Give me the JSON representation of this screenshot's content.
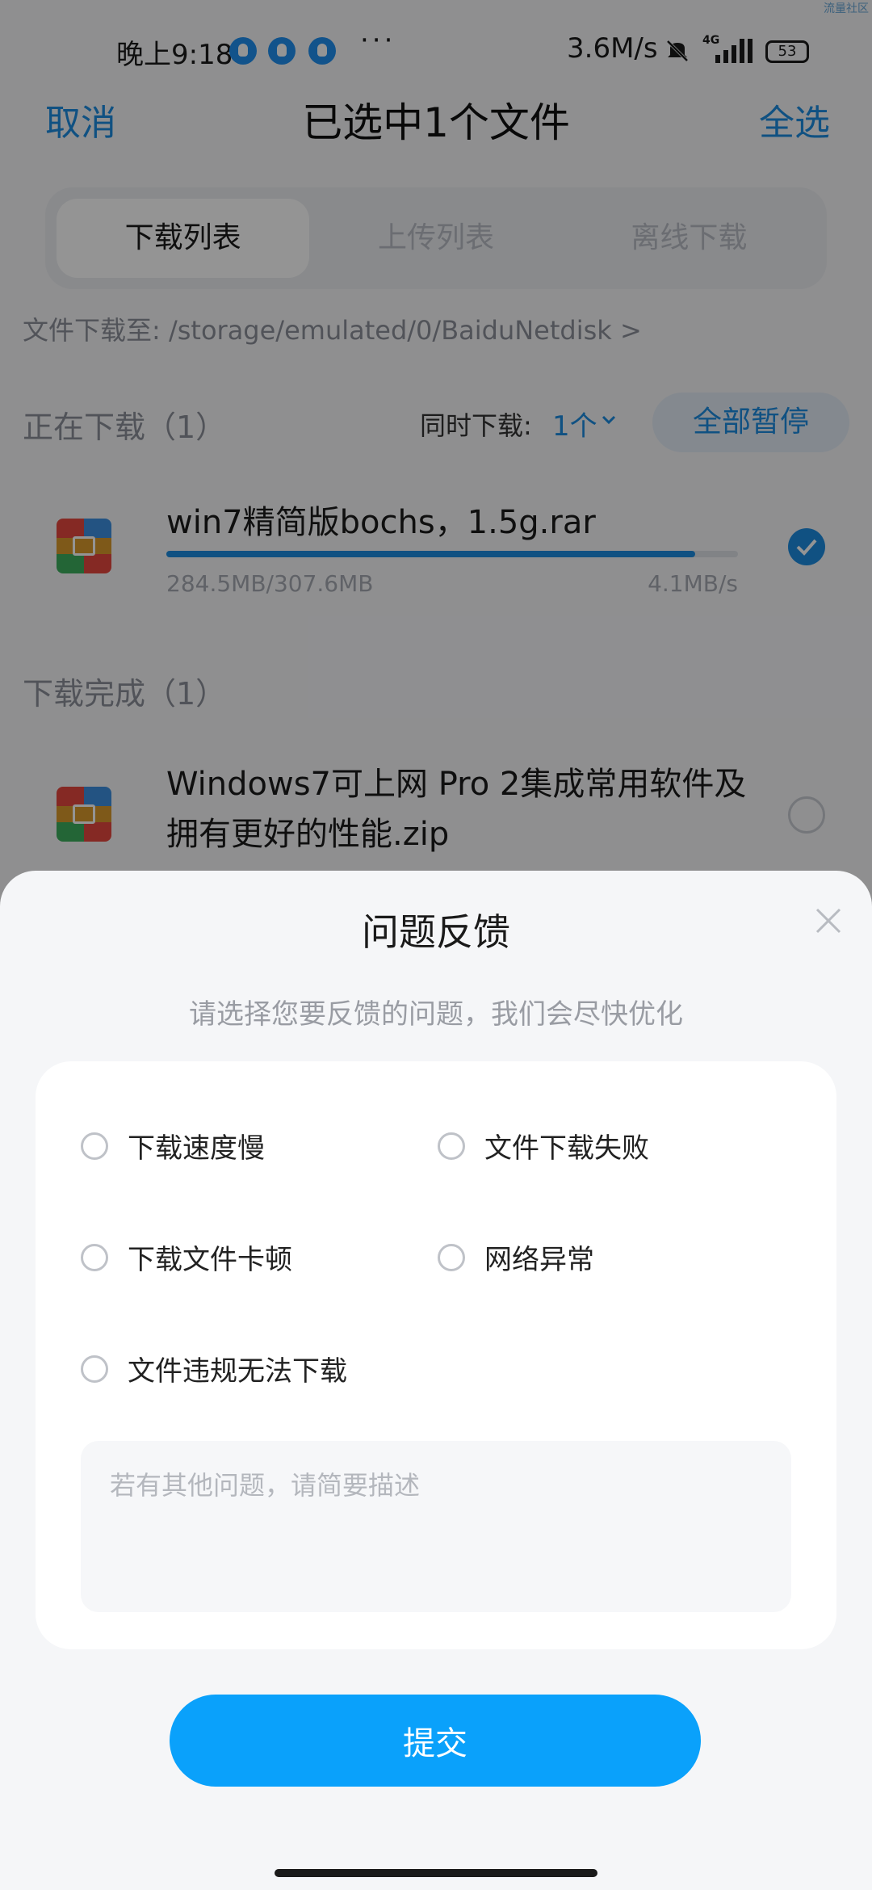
{
  "status_bar": {
    "time": "晚上9:18",
    "dots": "···",
    "speed": "3.6M/s",
    "network": "4G",
    "battery": "53",
    "corner_watermark": "流量社区"
  },
  "header": {
    "cancel": "取消",
    "title": "已选中1个文件",
    "select_all": "全选"
  },
  "tabs": [
    {
      "label": "下载列表",
      "active": true
    },
    {
      "label": "上传列表",
      "active": false
    },
    {
      "label": "离线下载",
      "active": false
    }
  ],
  "download_path": "文件下载至: /storage/emulated/0/BaiduNetdisk >",
  "downloading": {
    "section_label": "正在下载（1）",
    "concurrent_label": "同时下载:",
    "concurrent_value": "1个",
    "pause_all": "全部暂停",
    "items": [
      {
        "name": "win7精简版bochs，1.5g.rar",
        "size": "284.5MB/307.6MB",
        "rate": "4.1MB/s",
        "progress": 0.925,
        "selected": true
      }
    ]
  },
  "completed": {
    "section_label": "下载完成（1）",
    "items": [
      {
        "name": "Windows7可上网 Pro 2集成常用软件及拥有更好的性能.zip",
        "selected": false
      }
    ]
  },
  "feedback_sheet": {
    "title": "问题反馈",
    "subtitle": "请选择您要反馈的问题，我们会尽快优化",
    "options": [
      "下载速度慢",
      "文件下载失败",
      "下载文件卡顿",
      "网络异常",
      "文件违规无法下载"
    ],
    "description_placeholder": "若有其他问题，请简要描述",
    "submit": "提交"
  },
  "colors": {
    "accent": "#1d8ce0",
    "submit": "#0aa1fb"
  }
}
